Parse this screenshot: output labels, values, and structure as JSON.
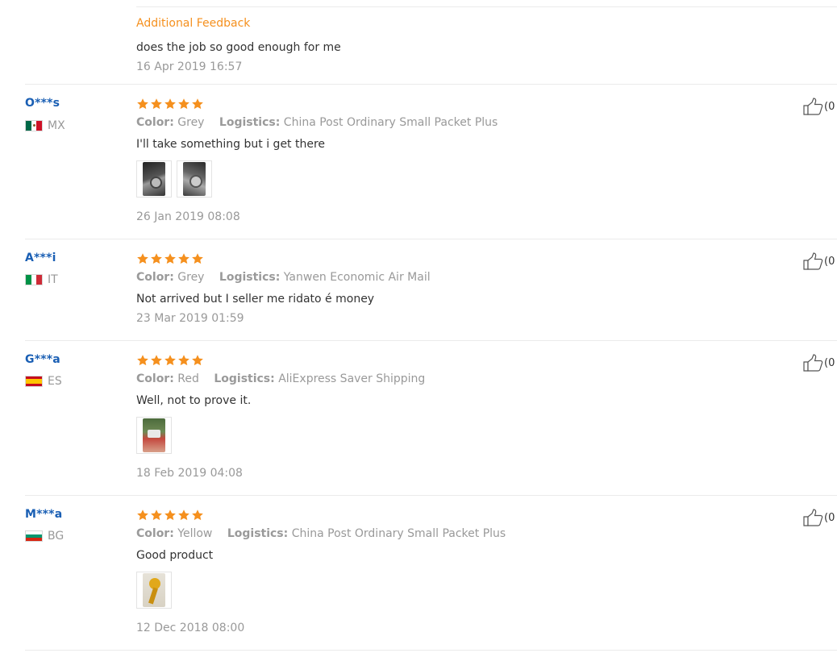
{
  "top": {
    "additional_label": "Additional Feedback",
    "text": "does the job so good enough for me",
    "date": "16 Apr 2019 16:57"
  },
  "reviews": [
    {
      "user": "O***s",
      "country": "MX",
      "color_label": "Color:",
      "color_value": "Grey",
      "logistics_label": "Logistics:",
      "logistics_value": "China Post Ordinary Small Packet Plus",
      "text": "I'll take something but i get there",
      "date": "26 Jan 2019 08:08",
      "like_count": "(0"
    },
    {
      "user": "A***i",
      "country": "IT",
      "color_label": "Color:",
      "color_value": "Grey",
      "logistics_label": "Logistics:",
      "logistics_value": "Yanwen Economic Air Mail",
      "text": "Not arrived but I seller me ridato é money",
      "date": "23 Mar 2019 01:59",
      "like_count": "(0"
    },
    {
      "user": "G***a",
      "country": "ES",
      "color_label": "Color:",
      "color_value": "Red",
      "logistics_label": "Logistics:",
      "logistics_value": "AliExpress Saver Shipping",
      "text": "Well, not to prove it.",
      "date": "18 Feb 2019 04:08",
      "like_count": "(0"
    },
    {
      "user": "M***a",
      "country": "BG",
      "color_label": "Color:",
      "color_value": "Yellow",
      "logistics_label": "Logistics:",
      "logistics_value": "China Post Ordinary Small Packet Plus",
      "text": "Good product",
      "date": "12 Dec 2018 08:00",
      "like_count": "(0"
    }
  ],
  "colors": {
    "star": "#f5901e",
    "username": "#1a5fb4",
    "muted": "#999999",
    "accent": "#f5901e"
  }
}
